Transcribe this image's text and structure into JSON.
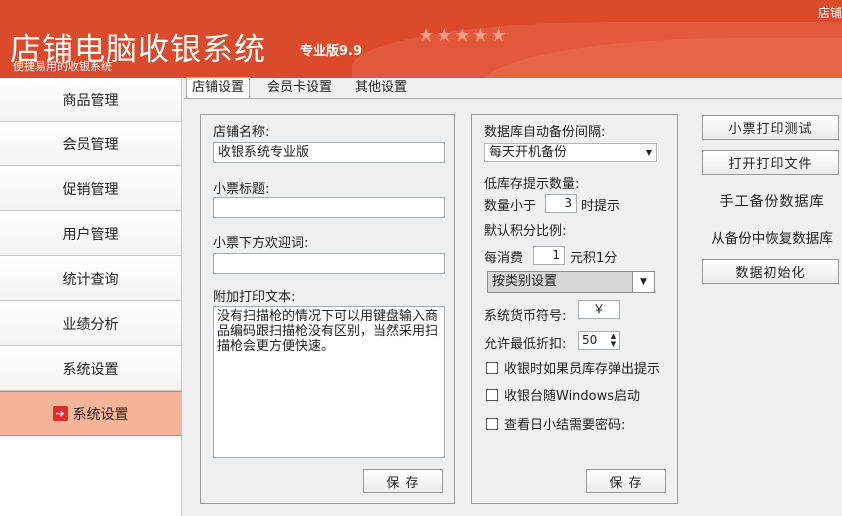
{
  "header": {
    "app_title": "店铺电脑收银系统",
    "version": "专业版9.9",
    "slogan": "便捷易用的收银系统",
    "stars": "★★★★★",
    "corner_text": "店铺"
  },
  "sidebar": {
    "items": [
      {
        "label": "商品管理"
      },
      {
        "label": "会员管理"
      },
      {
        "label": "促销管理"
      },
      {
        "label": "用户管理"
      },
      {
        "label": "统计查询"
      },
      {
        "label": "业绩分析"
      },
      {
        "label": "系统设置"
      },
      {
        "label": "系统设置",
        "icon": "arrow-right-icon",
        "active": true
      }
    ]
  },
  "tabs": [
    {
      "label": "店铺设置",
      "active": true
    },
    {
      "label": "会员卡设置"
    },
    {
      "label": "其他设置"
    }
  ],
  "shop_settings": {
    "shop_name_label": "店铺名称:",
    "shop_name_value": "收银系统专业版",
    "receipt_title_label": "小票标题:",
    "receipt_title_value": "",
    "receipt_welcome_label": "小票下方欢迎词:",
    "receipt_welcome_value": "",
    "extra_text_label": "附加打印文本:",
    "extra_text_value": "没有扫描枪的情况下可以用键盘输入商品编码跟扫描枪没有区别，当然采用扫描枪会更方便快速。",
    "save_label": "保 存"
  },
  "db_settings": {
    "backup_interval_label": "数据库自动备份间隔:",
    "backup_interval_value": "每天开机备份",
    "low_stock_label": "低库存提示数量:",
    "qty_less_label": "数量小于",
    "qty_less_value": "3",
    "qty_prompt_label": "时提示",
    "points_ratio_label": "默认积分比例:",
    "spend_label": "每消费",
    "spend_value": "1",
    "per_point_label": "元积1分",
    "points_mode_value": "按类别设置",
    "currency_label": "系统货币符号:",
    "currency_value": "￥",
    "min_discount_label": "允许最低折扣:",
    "min_discount_value": "50",
    "check_member_stock": "收银时如果员库存弹出提示",
    "check_autostart": "收银台随Windows启动",
    "check_daily_password": "查看日小结需要密码:",
    "save_label": "保 存"
  },
  "actions": {
    "print_test": "小票打印测试",
    "open_print_file": "打开打印文件",
    "manual_backup": "手工备份数据库",
    "restore_backup": "从备份中恢复数据库",
    "data_init": "数据初始化"
  },
  "colors": {
    "header_bg": "#dc4a2c",
    "sidebar_active_bg": "#f6b49a",
    "arrow_icon": "#d8322a"
  }
}
